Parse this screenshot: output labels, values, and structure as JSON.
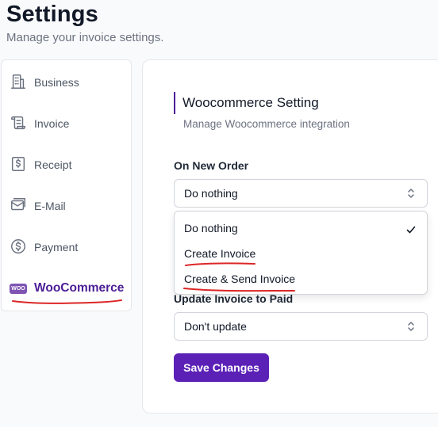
{
  "header": {
    "title": "Settings",
    "subtitle": "Manage your invoice settings."
  },
  "sidebar": {
    "items": [
      {
        "label": "Business",
        "icon": "building-icon"
      },
      {
        "label": "Invoice",
        "icon": "invoice-scroll-icon"
      },
      {
        "label": "Receipt",
        "icon": "dollar-receipt-icon"
      },
      {
        "label": "E-Mail",
        "icon": "mail-icon"
      },
      {
        "label": "Payment",
        "icon": "dollar-circle-icon"
      },
      {
        "label": "WooCommerce",
        "icon": "woocommerce-icon",
        "badge": "WOO",
        "active": true
      }
    ]
  },
  "section": {
    "title": "Woocommerce Setting",
    "subtitle": "Manage Woocommerce integration"
  },
  "fields": {
    "on_new_order": {
      "label": "On New Order",
      "value": "Do nothing",
      "options": [
        "Do nothing",
        "Create Invoice",
        "Create & Send Invoice"
      ],
      "selected": "Do nothing"
    },
    "update_invoice": {
      "label": "Update Invoice to Paid",
      "value": "Don't update"
    }
  },
  "actions": {
    "save_label": "Save Changes"
  },
  "colors": {
    "accent": "#5b21b6",
    "active_text": "#4c1d95",
    "annotation": "#dc2626"
  }
}
